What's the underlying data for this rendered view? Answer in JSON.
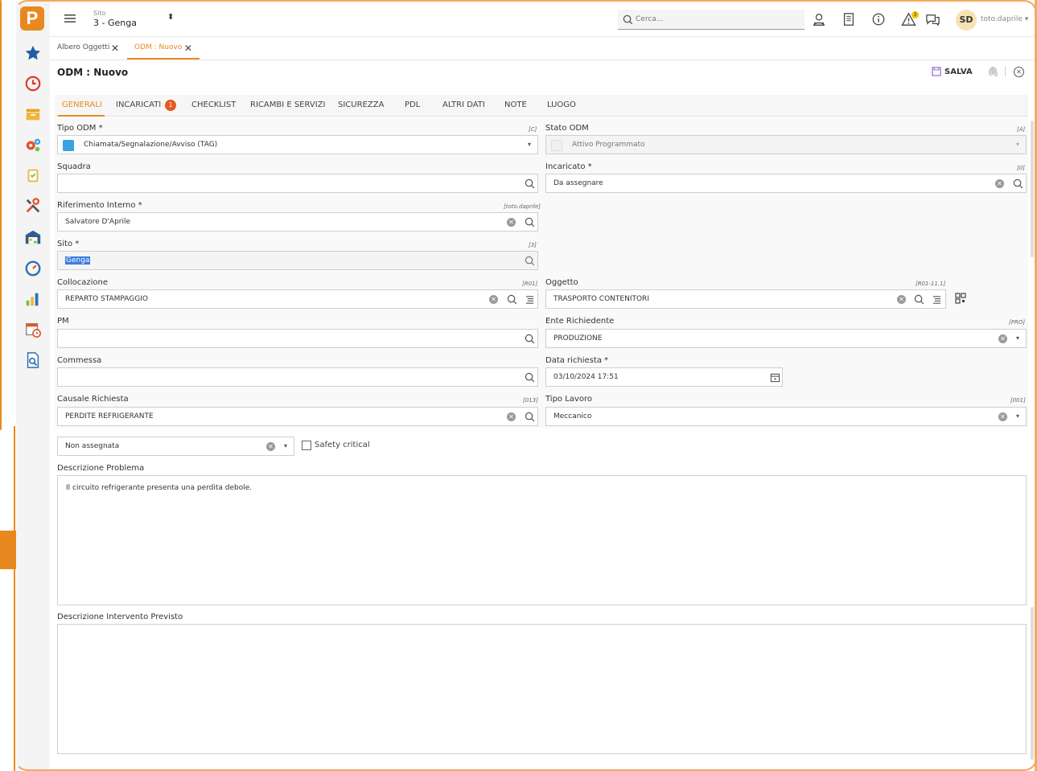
{
  "topbar": {
    "sito_label": "Sito",
    "sito_value": "3 - Genga",
    "search_placeholder": "Cerca...",
    "alert_count": "3",
    "avatar_initials": "SD",
    "username": "toto.daprile"
  },
  "doc_tabs": [
    {
      "label": "Albero Oggetti"
    },
    {
      "label": "ODM : Nuovo"
    }
  ],
  "page": {
    "title": "ODM : Nuovo",
    "save_label": "SALVA"
  },
  "sections": [
    {
      "label": "GENERALI"
    },
    {
      "label": "INCARICATI"
    },
    {
      "label": "CHECKLIST"
    },
    {
      "label": "RICAMBI E SERVIZI"
    },
    {
      "label": "SICUREZZA"
    },
    {
      "label": "PDL"
    },
    {
      "label": "ALTRI DATI"
    },
    {
      "label": "NOTE"
    },
    {
      "label": "LUOGO"
    }
  ],
  "incaricati_badge": "1",
  "form": {
    "tipo_odm": {
      "label": "Tipo ODM *",
      "code": "[C]",
      "value": "Chiamata/Segnalazione/Avviso (TAG)",
      "color": "#3aa2e0"
    },
    "stato_odm": {
      "label": "Stato ODM",
      "code": "[A]",
      "value": "Attivo Programmato"
    },
    "squadra": {
      "label": "Squadra",
      "value": ""
    },
    "incaricato": {
      "label": "Incaricato *",
      "code": "[0]",
      "value": "Da assegnare"
    },
    "riferimento": {
      "label": "Riferimento Interno *",
      "code": "[toto.daprile]",
      "value": "Salvatore D'Aprile"
    },
    "sito": {
      "label": "Sito *",
      "code": "[3]",
      "value": "Genga"
    },
    "collocazione": {
      "label": "Collocazione",
      "code": "[R01]",
      "value": "REPARTO STAMPAGGIO"
    },
    "oggetto": {
      "label": "Oggetto",
      "code": "[R01-11.1]",
      "value": "TRASPORTO CONTENITORI"
    },
    "pm": {
      "label": "PM",
      "value": ""
    },
    "ente": {
      "label": "Ente Richiedente",
      "code": "[PRO]",
      "value": "PRODUZIONE"
    },
    "commessa": {
      "label": "Commessa",
      "value": ""
    },
    "data_richiesta": {
      "label": "Data richiesta *",
      "value": "03/10/2024 17:51"
    },
    "causale": {
      "label": "Causale Richiesta",
      "code": "[013]",
      "value": "PERDITE REFRIGERANTE"
    },
    "tipo_lavoro": {
      "label": "Tipo Lavoro",
      "code": "[001]",
      "value": "Meccanico"
    },
    "priorita": {
      "value": "Non assegnata"
    },
    "safety_label": "Safety critical",
    "descrizione_problema": {
      "label": "Descrizione Problema",
      "value": "Il circuito refrigerante presenta una perdita debole."
    },
    "descrizione_intervento": {
      "label": "Descrizione Intervento Previsto",
      "value": ""
    }
  }
}
